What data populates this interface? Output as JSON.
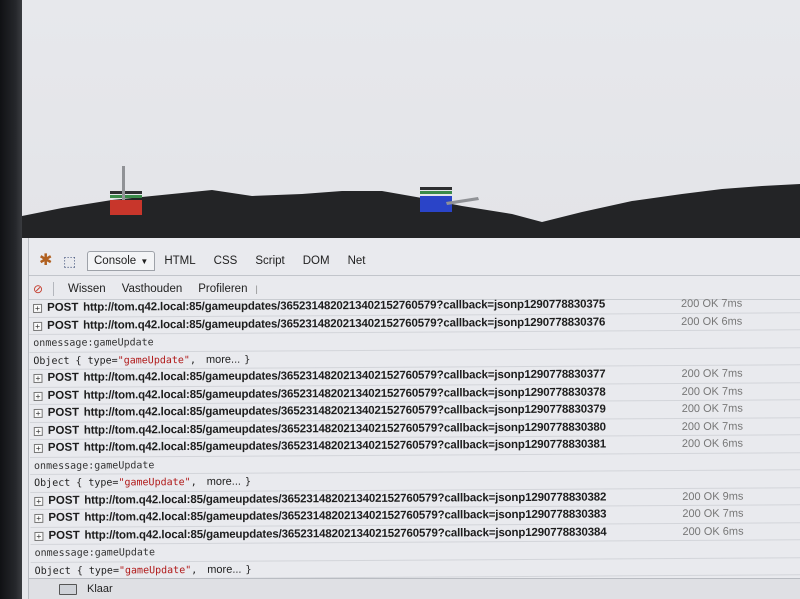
{
  "firebug": {
    "tabs": [
      {
        "label": "Console"
      },
      {
        "label": "HTML"
      },
      {
        "label": "CSS"
      },
      {
        "label": "Script"
      },
      {
        "label": "DOM"
      },
      {
        "label": "Net"
      }
    ],
    "toolbar": {
      "clear_label": "Wissen",
      "persist_label": "Vasthouden",
      "profile_label": "Profileren"
    }
  },
  "console": {
    "rows": [
      {
        "type": "req",
        "method": "POST",
        "url": "http://tom.q42.local:85/gameupdates/3652314820213402152760579?callback=jsonp1290778830375",
        "status": "200 OK 7ms"
      },
      {
        "type": "req",
        "method": "POST",
        "url": "http://tom.q42.local:85/gameupdates/3652314820213402152760579?callback=jsonp1290778830376",
        "status": "200 OK 6ms"
      },
      {
        "type": "msg",
        "text": "onmessage:gameUpdate"
      },
      {
        "type": "obj",
        "prefix": "Object {",
        "key": "type=",
        "value": "\"gameUpdate\"",
        "comma": ",",
        "more": "more...",
        "close": "}"
      },
      {
        "type": "req",
        "method": "POST",
        "url": "http://tom.q42.local:85/gameupdates/3652314820213402152760579?callback=jsonp1290778830377",
        "status": "200 OK 7ms"
      },
      {
        "type": "req",
        "method": "POST",
        "url": "http://tom.q42.local:85/gameupdates/3652314820213402152760579?callback=jsonp1290778830378",
        "status": "200 OK 7ms"
      },
      {
        "type": "req",
        "method": "POST",
        "url": "http://tom.q42.local:85/gameupdates/3652314820213402152760579?callback=jsonp1290778830379",
        "status": "200 OK 7ms"
      },
      {
        "type": "req",
        "method": "POST",
        "url": "http://tom.q42.local:85/gameupdates/3652314820213402152760579?callback=jsonp1290778830380",
        "status": "200 OK 7ms"
      },
      {
        "type": "req",
        "method": "POST",
        "url": "http://tom.q42.local:85/gameupdates/3652314820213402152760579?callback=jsonp1290778830381",
        "status": "200 OK 6ms"
      },
      {
        "type": "msg",
        "text": "onmessage:gameUpdate"
      },
      {
        "type": "obj",
        "prefix": "Object {",
        "key": "type=",
        "value": "\"gameUpdate\"",
        "comma": ",",
        "more": "more...",
        "close": "}"
      },
      {
        "type": "req",
        "method": "POST",
        "url": "http://tom.q42.local:85/gameupdates/3652314820213402152760579?callback=jsonp1290778830382",
        "status": "200 OK 9ms"
      },
      {
        "type": "req",
        "method": "POST",
        "url": "http://tom.q42.local:85/gameupdates/3652314820213402152760579?callback=jsonp1290778830383",
        "status": "200 OK 7ms"
      },
      {
        "type": "req",
        "method": "POST",
        "url": "http://tom.q42.local:85/gameupdates/3652314820213402152760579?callback=jsonp1290778830384",
        "status": "200 OK 6ms"
      },
      {
        "type": "msg",
        "text": "onmessage:gameUpdate"
      },
      {
        "type": "obj",
        "prefix": "Object {",
        "key": "type=",
        "value": "\"gameUpdate\"",
        "comma": ",",
        "more": "more...",
        "close": "}"
      }
    ]
  },
  "status_bar": {
    "text": "Klaar"
  },
  "game": {
    "colors": {
      "sky": "#e6e7eb",
      "terrain": "#232426",
      "red_tank": "#c8362b",
      "blue_tank": "#2a44c8"
    }
  }
}
